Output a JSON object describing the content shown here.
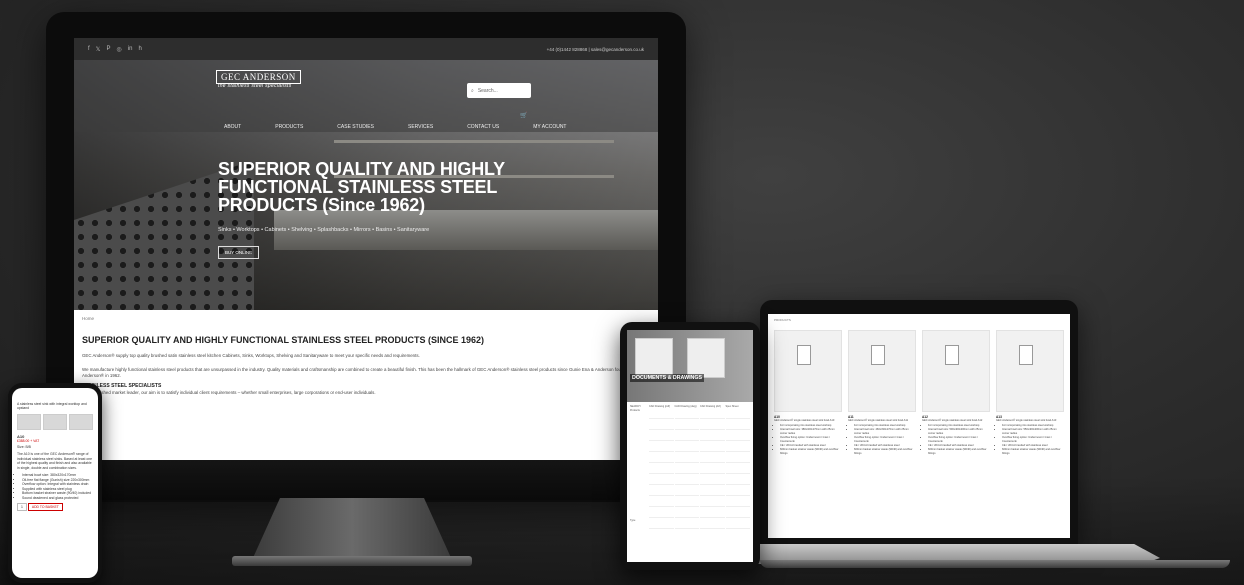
{
  "desktop": {
    "social_icons": [
      "facebook-icon",
      "twitter-icon",
      "pinterest-icon",
      "instagram-icon",
      "linkedin-icon",
      "houzz-icon"
    ],
    "social_glyphs": [
      "f",
      "𝕏",
      "P",
      "◎",
      "in",
      "h"
    ],
    "contact": "+44 (0)1442 828868 | sales@gecanderson.co.uk",
    "logo": "GEC ANDERSON",
    "logo_sub": "the stainless steel specialists",
    "search_placeholder": "Search...",
    "nav": [
      "ABOUT",
      "PRODUCTS",
      "CASE STUDIES",
      "SERVICES",
      "CONTACT US",
      "MY ACCOUNT"
    ],
    "hero_title": "SUPERIOR QUALITY AND HIGHLY FUNCTIONAL STAINLESS STEEL PRODUCTS (Since 1962)",
    "hero_sub": "Sinks • Worktops • Cabinets • Shelving • Splashbacks • Mirrors • Basins • Sanitaryware",
    "buy_label": "BUY ONLINE",
    "breadcrumb": "Home",
    "section_title": "SUPERIOR QUALITY AND HIGHLY FUNCTIONAL STAINLESS STEEL PRODUCTS (SINCE 1962)",
    "para1": "GEC Anderson® supply top quality brushed satin stainless steel kitchen Cabinets, Sinks, Worktops, Shelving and Sanitaryware to meet your specific needs and requirements.",
    "para2": "We manufacture highly functional stainless steel products that are unsurpassed in the industry. Quality materials and craftsmanship are combined to create a beautiful finish. This has been the hallmark of GEC Anderson® stainless steel products since Gunie Ena & Anderson founded GEC Anderson® in 1962.",
    "subhead": "STAINLESS STEEL SPECIALISTS",
    "para3": "An established market leader, our aim is to satisfy individual client requirements – whether small enterprises, large corporations or end-user individuals."
  },
  "phone_left": {
    "caption": "A stainless steel sink with integral worktop and upstand",
    "product_code": "A10",
    "price": "£388.00 + VAT",
    "size": "Size: B/B",
    "desc": "The A10 is one of the GEC Anderson® range of individual stainless steel sinks. Based at least one of the highest quality and finish and also available in single, double and combination sizes.",
    "bullets": [
      "Internal bowl size: 380x320x170mm",
      "Oil-free flat flange (Gunish) size 220x300mm",
      "Overflow option: Integral with stainless drain",
      "Supplied with stainless steel plug",
      "Bottom basket strainer waste (90/40) included",
      "Sound deadened and glass protected"
    ],
    "qty": "1",
    "add_label": "ADD TO BASKET"
  },
  "phone_mid": {
    "title": "DOCUMENTS & DRAWINGS",
    "filter_heading": "SEARCH",
    "products_heading": "Products",
    "type_heading": "Type",
    "columns": [
      "CAD Drawing (pdf)",
      "CAD Drawing (dwg)",
      "CAD Drawing (dxf)",
      "Spec Sheet"
    ]
  },
  "laptop": {
    "breadcrumb": "PRODUCTS",
    "products": [
      {
        "code": "A10",
        "title": "GEC Anderson® single stainless steel sink bowl A10",
        "bullets": [
          "For incorporating into stainless steel worktop",
          "Internal bowl size: 380x320x170mm with 25mm corner radius",
          "Overflow fixing option: Undermount / Inset / Countersunk",
          "CE / UKCA branded with stainless steel",
          "600mm basket strainer waste (90/40) and overflow fittings"
        ]
      },
      {
        "code": "A11",
        "title": "GEC Anderson® single stainless steel sink bowl A11",
        "bullets": [
          "For incorporating into stainless steel worktop",
          "Internal bowl size: 460x330x170mm with 25mm corner radius",
          "Overflow fixing option: Undermount / Inset / Countersunk",
          "CE / UKCA branded with stainless steel",
          "600mm basket strainer waste (90/40) and overflow fittings"
        ]
      },
      {
        "code": "A12",
        "title": "GEC Anderson® single stainless steel sink bowl A12",
        "bullets": [
          "For incorporating into stainless steel worktop",
          "Internal bowl size: 500x400x200mm with 25mm corner radius",
          "Overflow fixing option: Undermount / Inset / Countersunk",
          "CE / UKCA branded with stainless steel",
          "600mm basket strainer waste (90/40) and overflow fittings"
        ]
      },
      {
        "code": "A13",
        "title": "GEC Anderson® single stainless steel sink bowl A13",
        "bullets": [
          "For incorporating into stainless steel worktop",
          "Internal bowl size: 550x400x200mm with 25mm corner radius",
          "Overflow fixing option: Undermount / Inset / Countersunk",
          "CE / UKCA branded with stainless steel",
          "600mm basket strainer waste (90/40) and overflow fittings"
        ]
      }
    ]
  }
}
